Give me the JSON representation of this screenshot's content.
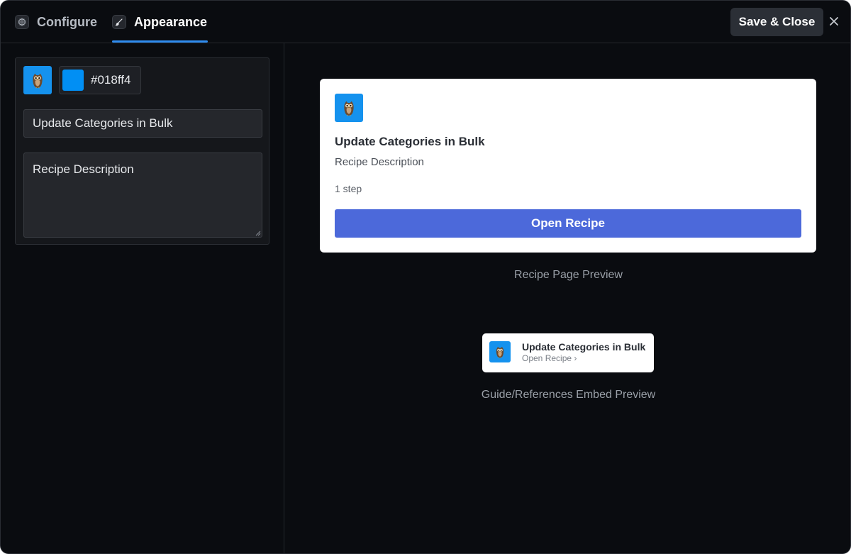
{
  "header": {
    "tabs": [
      {
        "label": "Configure",
        "icon": "gear-icon",
        "active": false
      },
      {
        "label": "Appearance",
        "icon": "brush-icon",
        "active": true
      }
    ],
    "save_label": "Save & Close",
    "close_icon": "close-icon"
  },
  "form": {
    "icon": "owl-icon",
    "color_value": "#018ff4",
    "title_value": "Update Categories in Bulk",
    "description_value": "Recipe Description"
  },
  "recipe_preview": {
    "title": "Update Categories in Bulk",
    "description": "Recipe Description",
    "steps": "1 step",
    "button_label": "Open Recipe",
    "caption": "Recipe Page Preview"
  },
  "embed_preview": {
    "title": "Update Categories in Bulk",
    "link_label": "Open Recipe",
    "chevron": "›",
    "caption": "Guide/References Embed Preview"
  },
  "colors": {
    "accent": "#2f8cf0",
    "icon_bg": "#1592ee",
    "swatch": "#018ff4",
    "open_button": "#4c69da"
  }
}
